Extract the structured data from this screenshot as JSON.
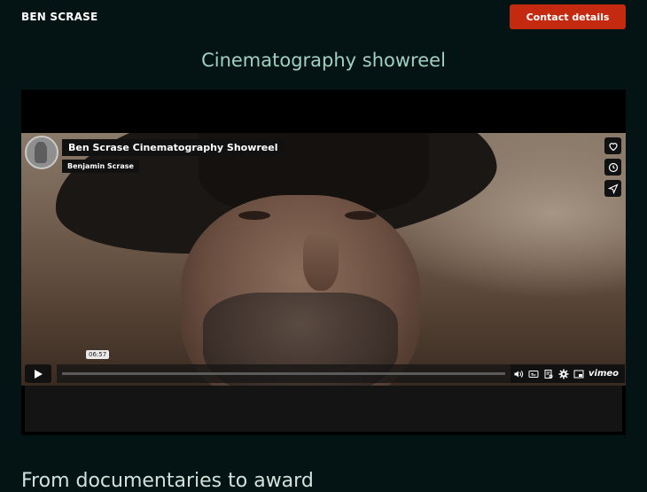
{
  "header": {
    "brand": "BEN SCRASE",
    "contact_label": "Contact details"
  },
  "page": {
    "title": "Cinematography showreel",
    "section_heading": "From documentaries to award"
  },
  "video": {
    "title": "Ben Scrase Cinematography Showreel",
    "author": "Benjamin Scrase",
    "time": "06:57",
    "provider": "vimeo",
    "progress": 0,
    "side_icons": [
      "heart-icon",
      "clock-icon",
      "share-icon"
    ],
    "control_icons": [
      "play-icon",
      "volume-icon",
      "captions-icon",
      "transcript-icon",
      "settings-icon",
      "pip-icon"
    ]
  },
  "colors": {
    "background": "#041414",
    "accent": "#c42a10",
    "title": "#9fd0c0"
  }
}
